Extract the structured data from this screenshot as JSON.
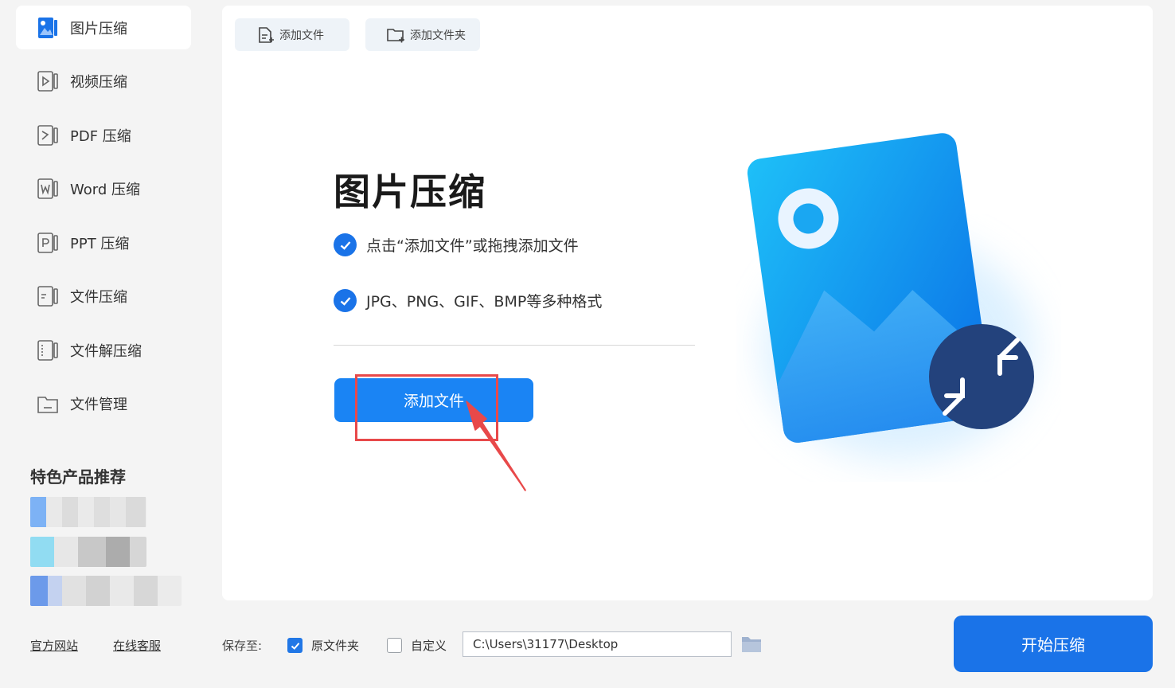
{
  "sidebar": {
    "items": [
      {
        "label": "图片压缩",
        "icon": "image-compress-icon",
        "active": true
      },
      {
        "label": "视频压缩",
        "icon": "video-compress-icon"
      },
      {
        "label": "PDF 压缩",
        "icon": "pdf-compress-icon"
      },
      {
        "label": "Word 压缩",
        "icon": "word-compress-icon"
      },
      {
        "label": "PPT 压缩",
        "icon": "ppt-compress-icon"
      },
      {
        "label": "文件压缩",
        "icon": "file-compress-icon"
      },
      {
        "label": "文件解压缩",
        "icon": "file-decompress-icon"
      },
      {
        "label": "文件管理",
        "icon": "file-manage-icon"
      }
    ],
    "featured_title": "特色产品推荐",
    "footer": {
      "website": "官方网站",
      "support": "在线客服"
    }
  },
  "toolbar": {
    "add_file": "添加文件",
    "add_folder": "添加文件夹"
  },
  "hero": {
    "title": "图片压缩",
    "features": [
      "点击“添加文件”或拖拽添加文件",
      "JPG、PNG、GIF、BMP等多种格式"
    ],
    "add_button": "添加文件"
  },
  "bottom": {
    "save_to_label": "保存至:",
    "original_folder": "原文件夹",
    "original_folder_checked": true,
    "custom": "自定义",
    "custom_checked": false,
    "path": "C:\\Users\\31177\\Desktop",
    "start_button": "开始压缩"
  },
  "colors": {
    "accent": "#1a73e8",
    "primary_button": "#1a84f4",
    "annotation": "#e8494a"
  }
}
